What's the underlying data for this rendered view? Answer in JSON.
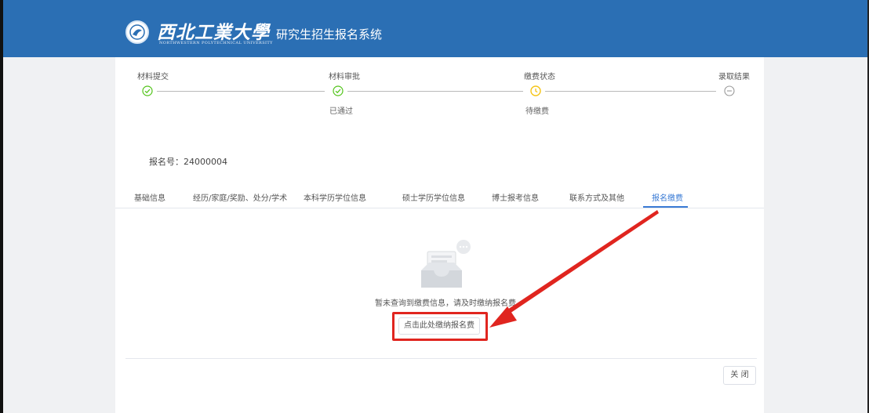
{
  "header": {
    "logo_cn": "西北工業大學",
    "logo_en": "NORTHWESTERN POLYTECHNICAL UNIVERSITY",
    "system_title": "研究生招生报名系统",
    "logo_icon": "university-seal-icon",
    "background_color": "#2b6fb4"
  },
  "steps": [
    {
      "label": "材料提交",
      "status": "done",
      "sub": "",
      "icon": "check-circle-icon"
    },
    {
      "label": "材料审批",
      "status": "done",
      "sub": "已通过",
      "icon": "check-circle-icon"
    },
    {
      "label": "缴费状态",
      "status": "pending",
      "sub": "待缴费",
      "icon": "clock-circle-icon"
    },
    {
      "label": "录取结果",
      "status": "waiting",
      "sub": "",
      "icon": "minus-circle-icon"
    }
  ],
  "registration": {
    "label": "报名号：",
    "number": "24000004"
  },
  "tabs": [
    {
      "label": "基础信息",
      "active": false
    },
    {
      "label": "经历/家庭/奖励、处分/学术",
      "active": false
    },
    {
      "label": "本科学历学位信息",
      "active": false
    },
    {
      "label": "硕士学历学位信息",
      "active": false
    },
    {
      "label": "博士报考信息",
      "active": false
    },
    {
      "label": "联系方式及其他",
      "active": false
    },
    {
      "label": "报名缴费",
      "active": true
    }
  ],
  "empty_state": {
    "message": "暂未查询到缴费信息，请及时缴纳报名费",
    "illustration": "empty-inbox-icon",
    "pay_button": "点击此处缴纳报名费"
  },
  "footer": {
    "close_button": "关 闭"
  },
  "colors": {
    "success": "#52c41a",
    "pending": "#f5c518",
    "accent": "#3a7bd5",
    "annotation": "#e0251f"
  }
}
